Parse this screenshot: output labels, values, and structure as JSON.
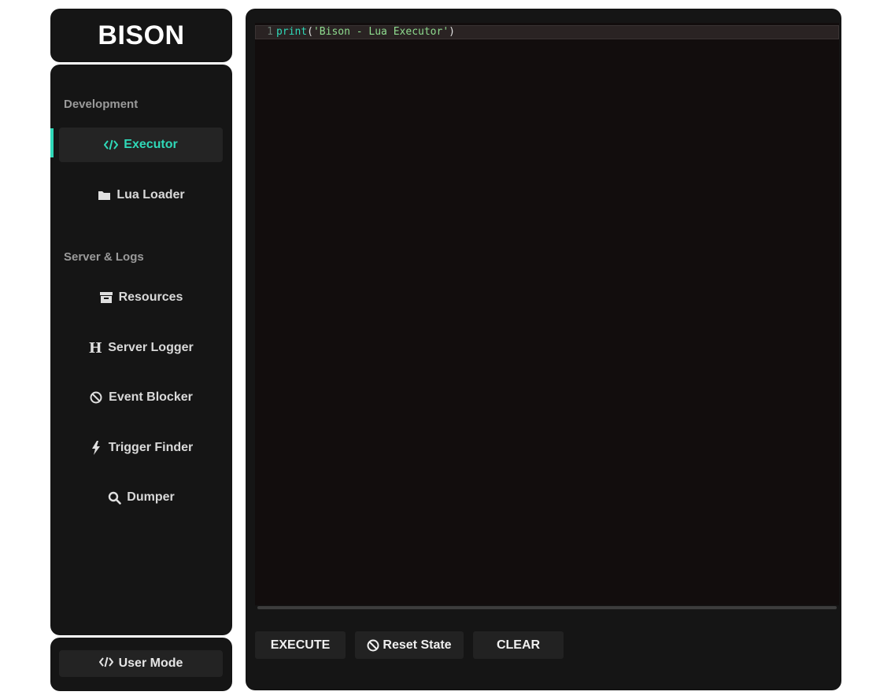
{
  "brand": {
    "title": "BISON"
  },
  "nav": {
    "sections": [
      {
        "label": "Development"
      },
      {
        "label": "Server & Logs"
      }
    ],
    "items": [
      {
        "label": "Executor",
        "icon": "code-icon",
        "active": true
      },
      {
        "label": "Lua Loader",
        "icon": "folder-icon"
      },
      {
        "label": "Resources",
        "icon": "archive-icon"
      },
      {
        "label": "Server Logger",
        "icon": "heading-icon"
      },
      {
        "label": "Event Blocker",
        "icon": "ban-icon"
      },
      {
        "label": "Trigger Finder",
        "icon": "bolt-icon"
      },
      {
        "label": "Dumper",
        "icon": "search-icon"
      }
    ]
  },
  "footer": {
    "user_mode_label": "User Mode",
    "icon": "code-icon"
  },
  "editor": {
    "line_number": "1",
    "tokens": {
      "fn": "print",
      "open": "(",
      "string": "'Bison - Lua Executor'",
      "close": ")"
    }
  },
  "actions": {
    "execute_label": "EXECUTE",
    "reset_label": "Reset State",
    "clear_label": "CLEAR"
  },
  "colors": {
    "accent": "#2fd8b8",
    "panel_bg": "#151515",
    "editor_bg": "#120d0d",
    "page_bg": "#ffffff"
  }
}
